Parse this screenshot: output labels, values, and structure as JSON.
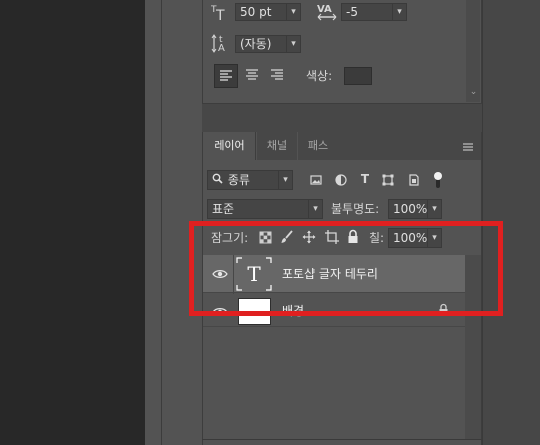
{
  "character": {
    "font_size": "50 pt",
    "tracking": "-5",
    "leading": "(자동)",
    "color_label": "색상:",
    "color_swatch": "#3b3b3b"
  },
  "layers_panel": {
    "tabs": [
      "레이어",
      "채널",
      "패스"
    ],
    "filter_kind": "종류",
    "blend_mode": "표준",
    "opacity_label": "불투명도:",
    "opacity_value": "100%",
    "lock_label": "잠그기:",
    "fill_label": "칠:",
    "fill_value": "100%",
    "layers": [
      {
        "name": "포토샵 글자 테두리",
        "type": "text",
        "thumb_glyph": "T"
      },
      {
        "name": "배경",
        "type": "background"
      }
    ]
  },
  "colors": {
    "highlight_box": "#e02020",
    "panel_bg": "#535353",
    "selected_row": "#676767"
  },
  "icons": [
    "text-size-icon",
    "tracking-icon",
    "leading-icon",
    "align-left-icon",
    "align-center-icon",
    "align-right-icon",
    "panel-menu-icon",
    "search-icon",
    "image-filter-icon",
    "adjustment-filter-icon",
    "type-filter-icon",
    "shape-filter-icon",
    "smart-object-filter-icon",
    "filter-toggle-icon",
    "lock-pixels-icon",
    "lock-paint-icon",
    "lock-move-icon",
    "lock-artboard-icon",
    "lock-all-icon",
    "eye-icon",
    "lock-icon"
  ]
}
